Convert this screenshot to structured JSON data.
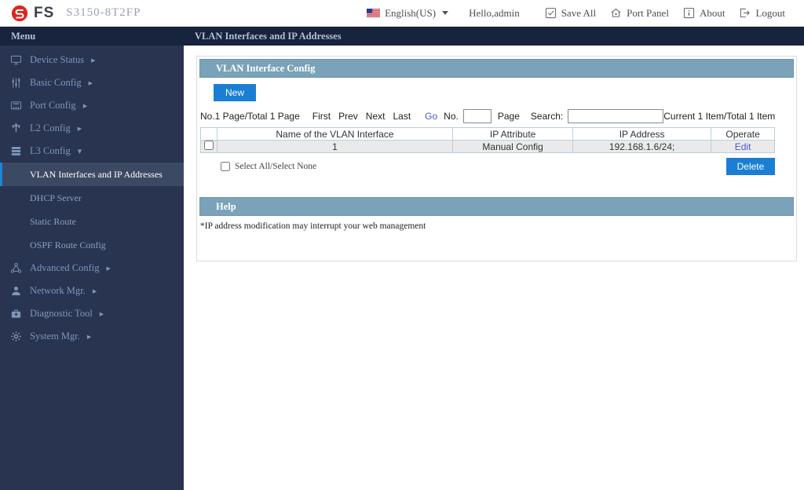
{
  "header": {
    "brand": "FS",
    "model": "S3150-8T2FP",
    "language": "English(US)",
    "greeting": "Hello,admin",
    "actions": {
      "save_all": "Save All",
      "port_panel": "Port Panel",
      "about": "About",
      "logout": "Logout"
    }
  },
  "menubar": {
    "menu_label": "Menu",
    "page_title": "VLAN Interfaces and IP Addresses"
  },
  "sidebar": {
    "items": [
      {
        "label": "Device Status",
        "icon": "monitor-icon",
        "arrow": "▶"
      },
      {
        "label": "Basic Config",
        "icon": "sliders-icon",
        "arrow": "▶"
      },
      {
        "label": "Port Config",
        "icon": "port-icon",
        "arrow": "▶"
      },
      {
        "label": "L2 Config",
        "icon": "topology-icon",
        "arrow": "▶"
      },
      {
        "label": "L3 Config",
        "icon": "layers-icon",
        "arrow": "▼"
      },
      {
        "label": "Advanced Config",
        "icon": "share-icon",
        "arrow": "▶"
      },
      {
        "label": "Network Mgr.",
        "icon": "person-icon",
        "arrow": "▶"
      },
      {
        "label": "Diagnostic Tool",
        "icon": "toolbox-icon",
        "arrow": "▶"
      },
      {
        "label": "System Mgr.",
        "icon": "gear-icon",
        "arrow": "▶"
      }
    ],
    "l3_children": [
      {
        "label": "VLAN Interfaces and IP Addresses",
        "selected": true
      },
      {
        "label": "DHCP Server",
        "selected": false
      },
      {
        "label": "Static Route",
        "selected": false
      },
      {
        "label": "OSPF Route Config",
        "selected": false
      }
    ]
  },
  "main": {
    "panel": {
      "title": "VLAN Interface Config",
      "new_button": "New",
      "pagination": {
        "page_info": "No.1 Page/Total 1 Page",
        "first": "First",
        "prev": "Prev",
        "next": "Next",
        "last": "Last",
        "go": "Go",
        "no_label": "No.",
        "page_label": "Page",
        "search_label": "Search:",
        "current_info": "Current 1 Item/Total 1 Item"
      },
      "table": {
        "columns": [
          "Name of the VLAN Interface",
          "IP Attribute",
          "IP Address",
          "Operate"
        ],
        "rows": [
          {
            "name": "1",
            "ip_attribute": "Manual Config",
            "ip_address": "192.168.1.6/24;",
            "operate": "Edit"
          }
        ]
      },
      "select_label": "Select All/Select None",
      "delete_button": "Delete"
    },
    "help": {
      "title": "Help",
      "text": "*IP address modification may interrupt your web management"
    }
  },
  "colors": {
    "accent_blue": "#1a7fd4",
    "panel_header_blue": "#7aa2b8",
    "sidebar_bg": "#283450",
    "menubar_bg": "#18233c",
    "selected_item_bg": "#3c4962",
    "selected_accent": "#1e84d9",
    "link_blue": "#4a5acb",
    "logo_red": "#e2231a",
    "row_gray": "#eaeaea",
    "table_border": "#b9cfdc"
  },
  "icons": {
    "chevron_right": "▶",
    "chevron_down": "▼"
  }
}
